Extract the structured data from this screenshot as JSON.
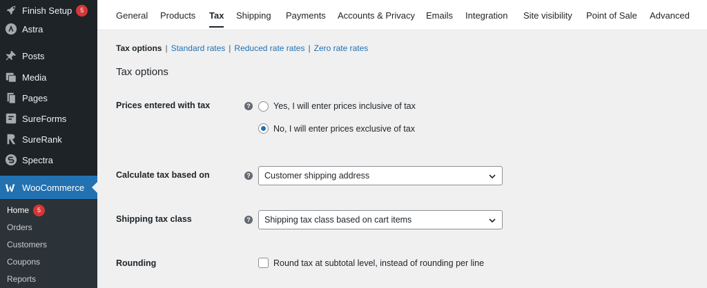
{
  "sidebar": {
    "items": [
      {
        "label": "Finish Setup",
        "badge": "5",
        "icon": "rocket-icon"
      },
      {
        "label": "Astra",
        "icon": "astra-icon"
      },
      {
        "label": "Posts",
        "icon": "pushpin-icon"
      },
      {
        "label": "Media",
        "icon": "media-icon"
      },
      {
        "label": "Pages",
        "icon": "pages-icon"
      },
      {
        "label": "SureForms",
        "icon": "sureforms-icon"
      },
      {
        "label": "SureRank",
        "icon": "surerank-icon"
      },
      {
        "label": "Spectra",
        "icon": "spectra-icon"
      },
      {
        "label": "WooCommerce",
        "icon": "woocommerce-icon"
      }
    ],
    "submenu": [
      {
        "label": "Home",
        "badge": "5"
      },
      {
        "label": "Orders"
      },
      {
        "label": "Customers"
      },
      {
        "label": "Coupons"
      },
      {
        "label": "Reports"
      }
    ]
  },
  "tabs": [
    "General",
    "Products",
    "Tax",
    "Shipping",
    "Payments",
    "Accounts & Privacy",
    "Emails",
    "Integration",
    "Site visibility",
    "Point of Sale",
    "Advanced"
  ],
  "active_tab": "Tax",
  "subnav": {
    "current": "Tax options",
    "links": [
      "Standard rates",
      "Reduced rate rates",
      "Zero rate rates"
    ]
  },
  "section_title": "Tax options",
  "fields": {
    "prices_entered": {
      "label": "Prices entered with tax",
      "options": [
        "Yes, I will enter prices inclusive of tax",
        "No, I will enter prices exclusive of tax"
      ],
      "selected": "No, I will enter prices exclusive of tax"
    },
    "calculate_based_on": {
      "label": "Calculate tax based on",
      "value": "Customer shipping address"
    },
    "shipping_tax_class": {
      "label": "Shipping tax class",
      "value": "Shipping tax class based on cart items"
    },
    "rounding": {
      "label": "Rounding",
      "checkbox_label": "Round tax at subtotal level, instead of rounding per line",
      "checked": false
    }
  },
  "help_glyph": "?",
  "colors": {
    "sidebar_bg": "#1d2327",
    "accent": "#2271b1",
    "badge": "#d63638"
  }
}
